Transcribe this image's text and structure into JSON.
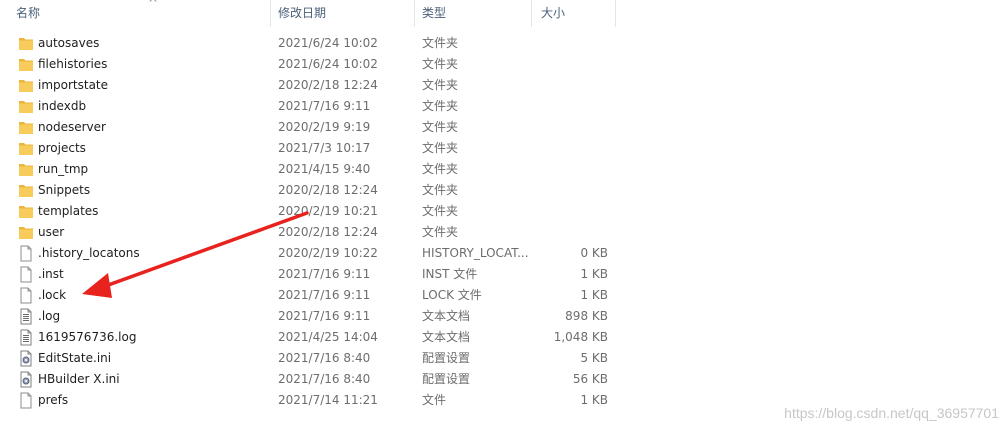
{
  "columns": {
    "name": "名称",
    "date": "修改日期",
    "type": "类型",
    "size": "大小"
  },
  "sort": {
    "column": "name",
    "direction": "ascending"
  },
  "files": [
    {
      "name": "autosaves",
      "date": "2021/6/24 10:02",
      "type": "文件夹",
      "size": "",
      "icon": "folder-icon"
    },
    {
      "name": "filehistories",
      "date": "2021/6/24 10:02",
      "type": "文件夹",
      "size": "",
      "icon": "folder-icon"
    },
    {
      "name": "importstate",
      "date": "2020/2/18 12:24",
      "type": "文件夹",
      "size": "",
      "icon": "folder-icon"
    },
    {
      "name": "indexdb",
      "date": "2021/7/16 9:11",
      "type": "文件夹",
      "size": "",
      "icon": "folder-icon"
    },
    {
      "name": "nodeserver",
      "date": "2020/2/19 9:19",
      "type": "文件夹",
      "size": "",
      "icon": "folder-icon"
    },
    {
      "name": "projects",
      "date": "2021/7/3 10:17",
      "type": "文件夹",
      "size": "",
      "icon": "folder-icon"
    },
    {
      "name": "run_tmp",
      "date": "2021/4/15 9:40",
      "type": "文件夹",
      "size": "",
      "icon": "folder-icon"
    },
    {
      "name": "Snippets",
      "date": "2020/2/18 12:24",
      "type": "文件夹",
      "size": "",
      "icon": "folder-icon"
    },
    {
      "name": "templates",
      "date": "2020/2/19 10:21",
      "type": "文件夹",
      "size": "",
      "icon": "folder-icon"
    },
    {
      "name": "user",
      "date": "2020/2/18 12:24",
      "type": "文件夹",
      "size": "",
      "icon": "folder-icon"
    },
    {
      "name": ".history_locatons",
      "date": "2020/2/19 10:22",
      "type": "HISTORY_LOCAT...",
      "size": "0 KB",
      "icon": "blank-file-icon"
    },
    {
      "name": ".inst",
      "date": "2021/7/16 9:11",
      "type": "INST 文件",
      "size": "1 KB",
      "icon": "blank-file-icon"
    },
    {
      "name": ".lock",
      "date": "2021/7/16 9:11",
      "type": "LOCK 文件",
      "size": "1 KB",
      "icon": "blank-file-icon"
    },
    {
      "name": ".log",
      "date": "2021/7/16 9:11",
      "type": "文本文档",
      "size": "898 KB",
      "icon": "text-file-icon"
    },
    {
      "name": "1619576736.log",
      "date": "2021/4/25 14:04",
      "type": "文本文档",
      "size": "1,048 KB",
      "icon": "text-file-icon"
    },
    {
      "name": "EditState.ini",
      "date": "2021/7/16 8:40",
      "type": "配置设置",
      "size": "5 KB",
      "icon": "settings-file-icon"
    },
    {
      "name": "HBuilder X.ini",
      "date": "2021/7/16 8:40",
      "type": "配置设置",
      "size": "56 KB",
      "icon": "settings-file-icon"
    },
    {
      "name": "prefs",
      "date": "2021/7/14 11:21",
      "type": "文件",
      "size": "1 KB",
      "icon": "blank-file-icon"
    }
  ],
  "annotation": {
    "color": "#e8231e",
    "points_to": ".lock"
  },
  "watermark": "https://blog.csdn.net/qq_36957701",
  "colors": {
    "header_text": "#4c607a",
    "folder": "#f5c447",
    "secondary_text": "#6d6d6d"
  }
}
